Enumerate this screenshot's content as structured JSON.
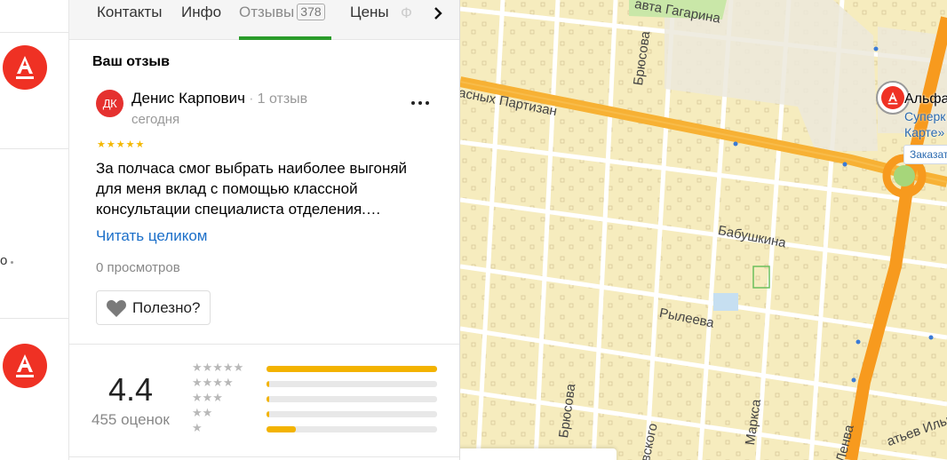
{
  "left_strip": {
    "bank_logo_icon": "alfa-bank-logo",
    "partial_text": "о"
  },
  "tabs": {
    "items": [
      {
        "label": "Контакты"
      },
      {
        "label": "Инфо"
      },
      {
        "label": "Отзывы",
        "count": "378",
        "active": true
      },
      {
        "label": "Цены"
      }
    ],
    "truncated_next_label": "Ф",
    "next_icon": "chevron-right-icon"
  },
  "your_review": {
    "title": "Ваш отзыв",
    "author": {
      "initials": "ДК",
      "name": "Денис Карпович",
      "reviews": "1 отзыв",
      "date": "сегодня",
      "avatar_color": "#e5312f"
    },
    "rating_stars": 5,
    "text": "За полчаса смог выбрать наиболее выгоняй для меня вклад с помощью классной консультации специалиста отделения.…",
    "read_more": "Читать целиком",
    "views": "0 просмотров",
    "helpful_label": "Полезно?",
    "more_icon": "more-dots-icon",
    "helpful_icon": "heart-icon"
  },
  "summary": {
    "rating": "4.4",
    "count": "455 оценок",
    "distribution": [
      {
        "stars": 5,
        "fraction": 1.0
      },
      {
        "stars": 4,
        "fraction": 0.01
      },
      {
        "stars": 3,
        "fraction": 0.01
      },
      {
        "stars": 2,
        "fraction": 0.01
      },
      {
        "stars": 1,
        "fraction": 0.17
      }
    ],
    "bar_color": "#f3b300"
  },
  "map": {
    "streets": [
      {
        "name": "Народных Партизан",
        "shown": "асных Партизан"
      },
      {
        "name": "проспект Гагарина",
        "shown": "авта Гагарина"
      },
      {
        "name": "Брюсова",
        "shown": "Брюсова"
      },
      {
        "name": "Бабушкина",
        "shown": "Бабушкина"
      },
      {
        "name": "Рылеева",
        "shown": "Рылеева"
      },
      {
        "name": "Маркса",
        "shown": "Маркса"
      },
      {
        "name": "Брюсова (south)",
        "shown": "Брюсова"
      },
      {
        "name": "Ленина",
        "shown": "Ленва"
      },
      {
        "name": "Котовского",
        "shown": "вского"
      },
      {
        "name": "Матвеева",
        "shown": "атьев Ильи"
      }
    ],
    "poi": {
      "title": "Альфа",
      "subtitle_line1": "Суперк",
      "subtitle_line2": "Карте»",
      "order_chip": "Заказать"
    },
    "road_color": "#f7b134",
    "background": "#f6ecbe"
  }
}
